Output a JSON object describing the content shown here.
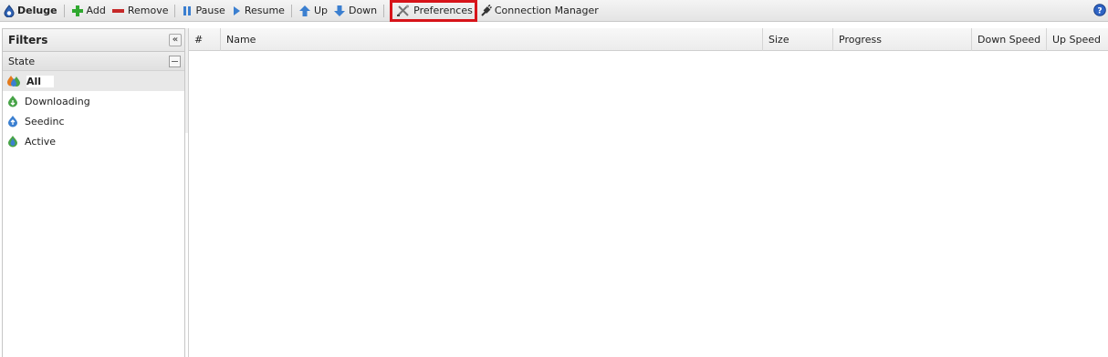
{
  "toolbar": {
    "brand": "Deluge",
    "add": "Add",
    "remove": "Remove",
    "pause": "Pause",
    "resume": "Resume",
    "up": "Up",
    "down": "Down",
    "preferences": "Preferences",
    "connection_manager": "Connection Manager",
    "icons": [
      "deluge-logo-icon",
      "add-icon",
      "remove-icon",
      "pause-icon",
      "resume-icon",
      "up-arrow-icon",
      "down-arrow-icon",
      "preferences-icon",
      "connection-plug-icon",
      "help-icon"
    ]
  },
  "filters": {
    "title": "Filters",
    "collapse_symbol": "«",
    "state_label": "State",
    "items": [
      {
        "label": "All",
        "icon": "all-torrents-icon",
        "selected": true
      },
      {
        "label": "Downloading",
        "icon": "downloading-icon",
        "selected": false
      },
      {
        "label": "Seedinc",
        "icon": "seeding-icon",
        "selected": false
      },
      {
        "label": "Active",
        "icon": "active-icon",
        "selected": false
      }
    ]
  },
  "grid": {
    "columns": [
      "#",
      "Name",
      "Size",
      "Progress",
      "Down Speed",
      "Up Speed"
    ]
  },
  "colors": {
    "highlight": "#d7141a",
    "add_green": "#2fa82f",
    "remove_red": "#c62828",
    "blue": "#3b7fd0"
  }
}
